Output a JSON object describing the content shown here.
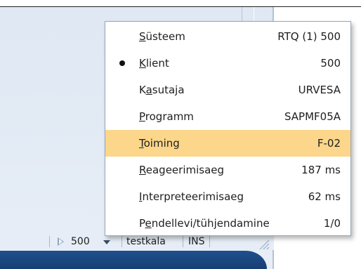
{
  "menu": {
    "items": [
      {
        "mnemonic": "S",
        "label_rest": "üsteem",
        "value": "RTQ (1) 500",
        "checked": false,
        "highlighted": false
      },
      {
        "mnemonic": "K",
        "label_rest": "lient",
        "value": "500",
        "checked": true,
        "highlighted": false
      },
      {
        "label_pre": "K",
        "mnemonic": "a",
        "label_rest": "sutaja",
        "value": "URVESA",
        "checked": false,
        "highlighted": false
      },
      {
        "mnemonic": "P",
        "label_rest": "rogramm",
        "value": "SAPMF05A",
        "checked": false,
        "highlighted": false
      },
      {
        "mnemonic": "T",
        "label_rest": "oiming",
        "value": "F-02",
        "checked": false,
        "highlighted": true
      },
      {
        "mnemonic": "R",
        "label_rest": "eageerimisaeg",
        "value": "187 ms",
        "checked": false,
        "highlighted": false
      },
      {
        "mnemonic": "I",
        "label_rest": "nterpreteerimisaeg",
        "value": "62 ms",
        "checked": false,
        "highlighted": false
      },
      {
        "label_pre": "P",
        "mnemonic": "e",
        "label_rest": "ndellevi/tühjendamine",
        "value": "1/0",
        "checked": false,
        "highlighted": false
      }
    ],
    "highlight_color": "#fcd68a"
  },
  "statusbar": {
    "client": "500",
    "server": "testkala",
    "mode": "INS"
  }
}
